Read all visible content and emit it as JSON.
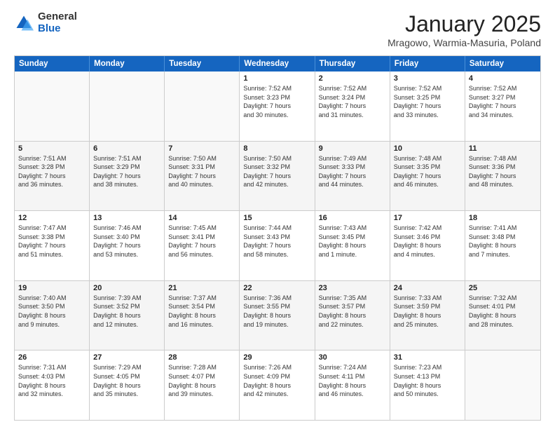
{
  "logo": {
    "general": "General",
    "blue": "Blue"
  },
  "title": "January 2025",
  "subtitle": "Mragowo, Warmia-Masuria, Poland",
  "header_days": [
    "Sunday",
    "Monday",
    "Tuesday",
    "Wednesday",
    "Thursday",
    "Friday",
    "Saturday"
  ],
  "rows": [
    [
      {
        "day": "",
        "info": ""
      },
      {
        "day": "",
        "info": ""
      },
      {
        "day": "",
        "info": ""
      },
      {
        "day": "1",
        "info": "Sunrise: 7:52 AM\nSunset: 3:23 PM\nDaylight: 7 hours\nand 30 minutes."
      },
      {
        "day": "2",
        "info": "Sunrise: 7:52 AM\nSunset: 3:24 PM\nDaylight: 7 hours\nand 31 minutes."
      },
      {
        "day": "3",
        "info": "Sunrise: 7:52 AM\nSunset: 3:25 PM\nDaylight: 7 hours\nand 33 minutes."
      },
      {
        "day": "4",
        "info": "Sunrise: 7:52 AM\nSunset: 3:27 PM\nDaylight: 7 hours\nand 34 minutes."
      }
    ],
    [
      {
        "day": "5",
        "info": "Sunrise: 7:51 AM\nSunset: 3:28 PM\nDaylight: 7 hours\nand 36 minutes."
      },
      {
        "day": "6",
        "info": "Sunrise: 7:51 AM\nSunset: 3:29 PM\nDaylight: 7 hours\nand 38 minutes."
      },
      {
        "day": "7",
        "info": "Sunrise: 7:50 AM\nSunset: 3:31 PM\nDaylight: 7 hours\nand 40 minutes."
      },
      {
        "day": "8",
        "info": "Sunrise: 7:50 AM\nSunset: 3:32 PM\nDaylight: 7 hours\nand 42 minutes."
      },
      {
        "day": "9",
        "info": "Sunrise: 7:49 AM\nSunset: 3:33 PM\nDaylight: 7 hours\nand 44 minutes."
      },
      {
        "day": "10",
        "info": "Sunrise: 7:48 AM\nSunset: 3:35 PM\nDaylight: 7 hours\nand 46 minutes."
      },
      {
        "day": "11",
        "info": "Sunrise: 7:48 AM\nSunset: 3:36 PM\nDaylight: 7 hours\nand 48 minutes."
      }
    ],
    [
      {
        "day": "12",
        "info": "Sunrise: 7:47 AM\nSunset: 3:38 PM\nDaylight: 7 hours\nand 51 minutes."
      },
      {
        "day": "13",
        "info": "Sunrise: 7:46 AM\nSunset: 3:40 PM\nDaylight: 7 hours\nand 53 minutes."
      },
      {
        "day": "14",
        "info": "Sunrise: 7:45 AM\nSunset: 3:41 PM\nDaylight: 7 hours\nand 56 minutes."
      },
      {
        "day": "15",
        "info": "Sunrise: 7:44 AM\nSunset: 3:43 PM\nDaylight: 7 hours\nand 58 minutes."
      },
      {
        "day": "16",
        "info": "Sunrise: 7:43 AM\nSunset: 3:45 PM\nDaylight: 8 hours\nand 1 minute."
      },
      {
        "day": "17",
        "info": "Sunrise: 7:42 AM\nSunset: 3:46 PM\nDaylight: 8 hours\nand 4 minutes."
      },
      {
        "day": "18",
        "info": "Sunrise: 7:41 AM\nSunset: 3:48 PM\nDaylight: 8 hours\nand 7 minutes."
      }
    ],
    [
      {
        "day": "19",
        "info": "Sunrise: 7:40 AM\nSunset: 3:50 PM\nDaylight: 8 hours\nand 9 minutes."
      },
      {
        "day": "20",
        "info": "Sunrise: 7:39 AM\nSunset: 3:52 PM\nDaylight: 8 hours\nand 12 minutes."
      },
      {
        "day": "21",
        "info": "Sunrise: 7:37 AM\nSunset: 3:54 PM\nDaylight: 8 hours\nand 16 minutes."
      },
      {
        "day": "22",
        "info": "Sunrise: 7:36 AM\nSunset: 3:55 PM\nDaylight: 8 hours\nand 19 minutes."
      },
      {
        "day": "23",
        "info": "Sunrise: 7:35 AM\nSunset: 3:57 PM\nDaylight: 8 hours\nand 22 minutes."
      },
      {
        "day": "24",
        "info": "Sunrise: 7:33 AM\nSunset: 3:59 PM\nDaylight: 8 hours\nand 25 minutes."
      },
      {
        "day": "25",
        "info": "Sunrise: 7:32 AM\nSunset: 4:01 PM\nDaylight: 8 hours\nand 28 minutes."
      }
    ],
    [
      {
        "day": "26",
        "info": "Sunrise: 7:31 AM\nSunset: 4:03 PM\nDaylight: 8 hours\nand 32 minutes."
      },
      {
        "day": "27",
        "info": "Sunrise: 7:29 AM\nSunset: 4:05 PM\nDaylight: 8 hours\nand 35 minutes."
      },
      {
        "day": "28",
        "info": "Sunrise: 7:28 AM\nSunset: 4:07 PM\nDaylight: 8 hours\nand 39 minutes."
      },
      {
        "day": "29",
        "info": "Sunrise: 7:26 AM\nSunset: 4:09 PM\nDaylight: 8 hours\nand 42 minutes."
      },
      {
        "day": "30",
        "info": "Sunrise: 7:24 AM\nSunset: 4:11 PM\nDaylight: 8 hours\nand 46 minutes."
      },
      {
        "day": "31",
        "info": "Sunrise: 7:23 AM\nSunset: 4:13 PM\nDaylight: 8 hours\nand 50 minutes."
      },
      {
        "day": "",
        "info": ""
      }
    ]
  ]
}
